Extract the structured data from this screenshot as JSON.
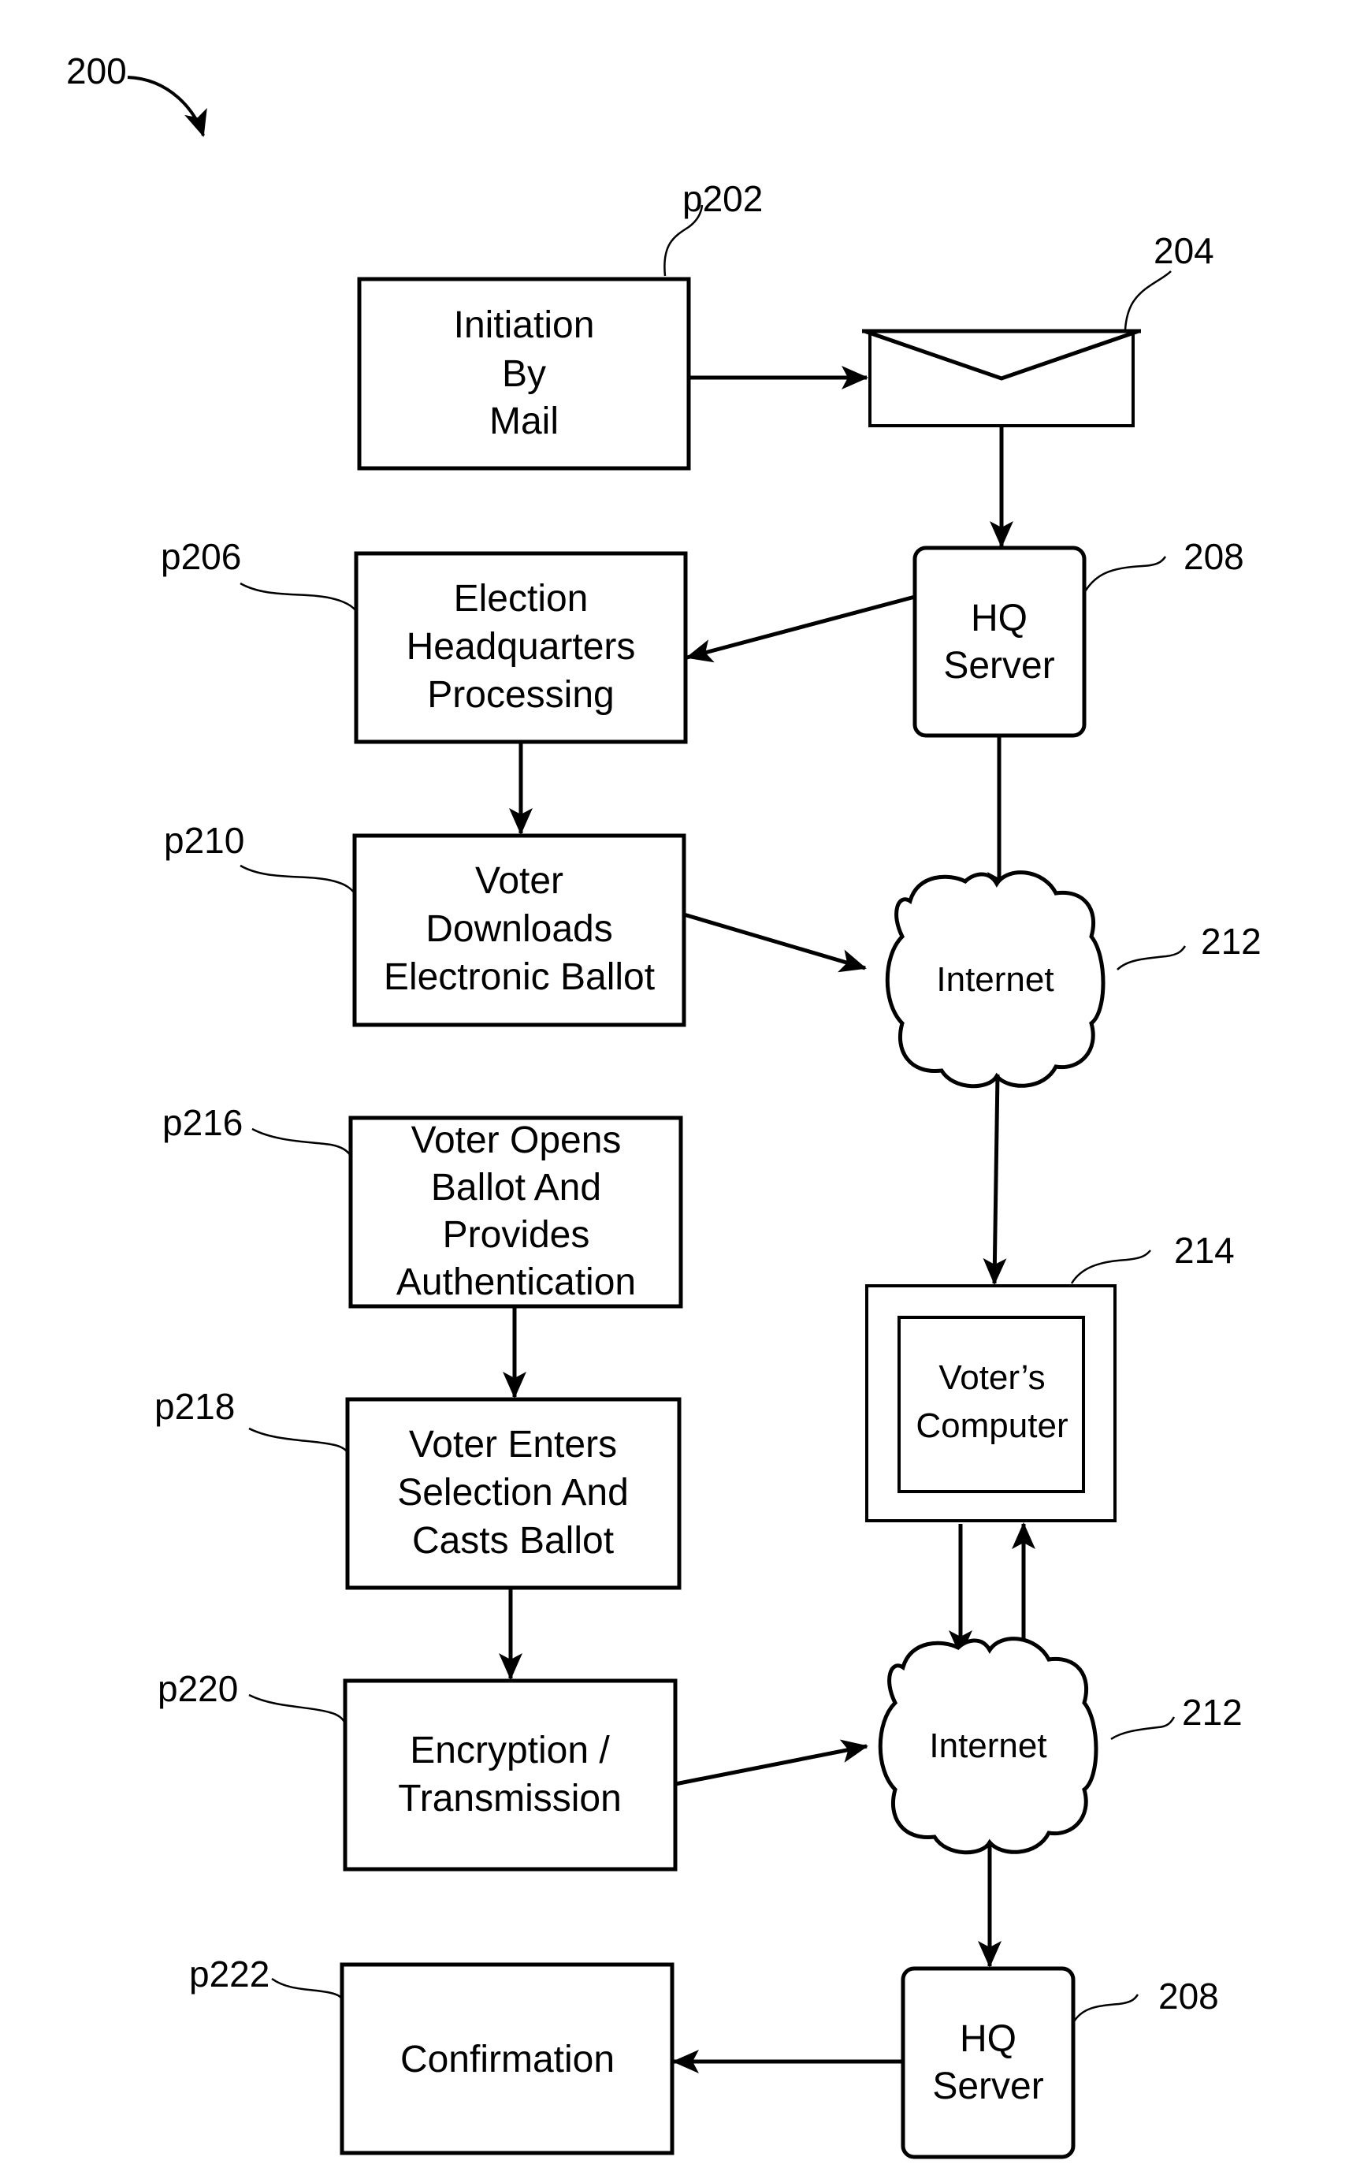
{
  "figure": {
    "ref": "200"
  },
  "nodes": {
    "p202": {
      "ref": "p202",
      "lines": [
        "Initiation",
        "By",
        "Mail"
      ]
    },
    "envelope": {
      "ref": "204"
    },
    "hq_server_top": {
      "ref": "208",
      "lines": [
        "HQ",
        "Server"
      ]
    },
    "p206": {
      "ref": "p206",
      "lines": [
        "Election",
        "Headquarters",
        "Processing"
      ]
    },
    "p210": {
      "ref": "p210",
      "lines": [
        "Voter",
        "Downloads",
        "Electronic Ballot"
      ]
    },
    "internet_top": {
      "ref": "212",
      "label": "Internet"
    },
    "p216": {
      "ref": "p216",
      "lines": [
        "Voter Opens",
        "Ballot And",
        "Provides",
        "Authentication"
      ]
    },
    "voters_computer": {
      "ref": "214",
      "lines": [
        "Voter’s",
        "Computer"
      ]
    },
    "p218": {
      "ref": "p218",
      "lines": [
        "Voter Enters",
        "Selection And",
        "Casts Ballot"
      ]
    },
    "p220": {
      "ref": "p220",
      "lines": [
        "Encryption /",
        "Transmission"
      ]
    },
    "internet_bottom": {
      "ref": "212",
      "label": "Internet"
    },
    "p222": {
      "ref": "p222",
      "lines": [
        "Confirmation"
      ]
    },
    "hq_server_bottom": {
      "ref": "208",
      "lines": [
        "HQ",
        "Server"
      ]
    }
  }
}
